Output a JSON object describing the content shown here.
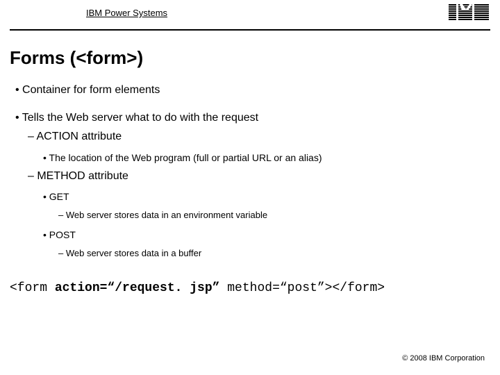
{
  "header": {
    "label": "IBM Power Systems",
    "logo_alt": "IBM"
  },
  "title": "Forms (<form>)",
  "bullets": {
    "b1": "Container for form elements",
    "b2": "Tells the Web server what to do with the request",
    "b2_1": "ACTION attribute",
    "b2_1_1": "The location of the Web program (full or partial URL or an alias)",
    "b2_2": "METHOD attribute",
    "b2_2_1": "GET",
    "b2_2_1_1": "Web server stores data in an environment variable",
    "b2_2_2": "POST",
    "b2_2_2_1": "Web server stores data in a buffer"
  },
  "code": {
    "pre": "<form ",
    "bold": "action=“/request. jsp”",
    "post": " method=“post”></form>"
  },
  "footer": "© 2008 IBM Corporation"
}
